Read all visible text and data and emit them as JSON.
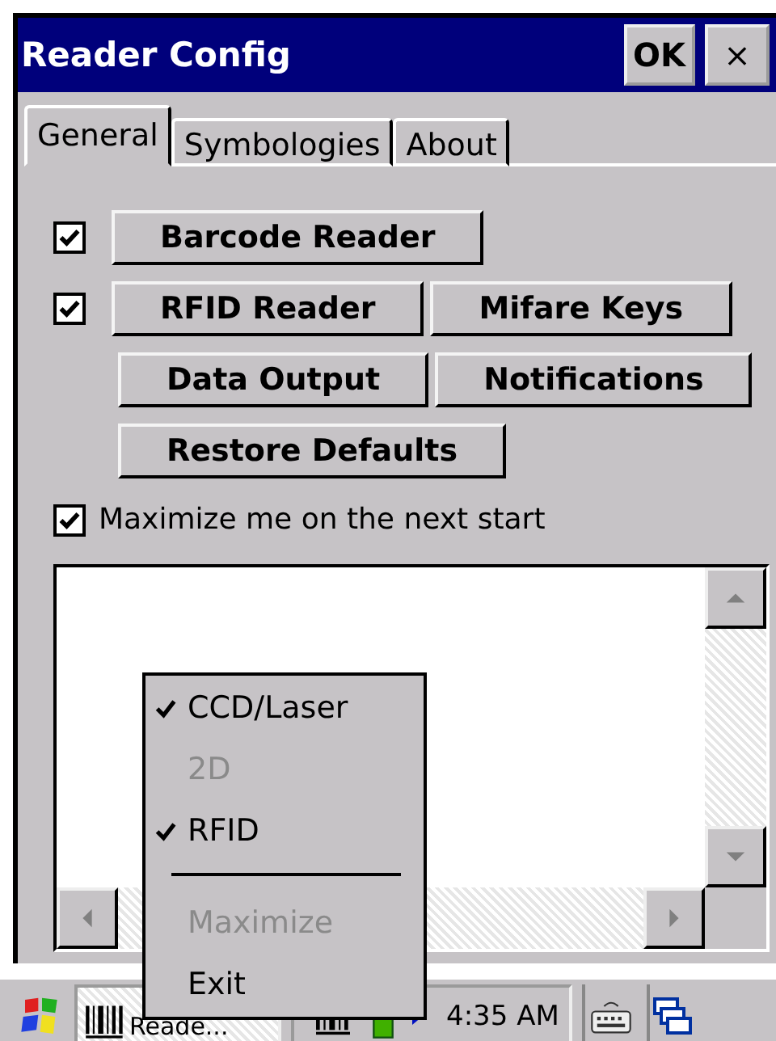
{
  "window": {
    "title": "Reader Config",
    "buttons": [
      {
        "label": "OK",
        "kind": "ok"
      },
      {
        "label": "×",
        "kind": "close"
      }
    ]
  },
  "tabs": [
    {
      "label": "General",
      "selected": true
    },
    {
      "label": "Symbologies",
      "selected": false
    },
    {
      "label": "About",
      "selected": false
    }
  ],
  "options": [
    {
      "kind": "check",
      "checked": true,
      "buttons": [
        "Barcode Reader"
      ]
    },
    {
      "kind": "check",
      "checked": true,
      "buttons": [
        "RFID Reader",
        "Mifare Keys"
      ]
    },
    {
      "kind": "plain",
      "buttons": [
        "Data Output",
        "Notifications"
      ]
    },
    {
      "kind": "plain",
      "buttons": [
        "Restore Defaults"
      ]
    }
  ],
  "maximize": {
    "label": "Maximize me on the next start",
    "checked": true
  },
  "context_menu": {
    "items": [
      {
        "kind": "item",
        "label": "CCD/Laser",
        "checked": true,
        "disabled": false
      },
      {
        "kind": "item",
        "label": "2D",
        "checked": false,
        "disabled": true
      },
      {
        "kind": "item",
        "label": "RFID",
        "checked": true,
        "disabled": false
      },
      {
        "kind": "separator"
      },
      {
        "kind": "item",
        "label": "Maximize",
        "checked": false,
        "disabled": true
      },
      {
        "kind": "item",
        "label": "Exit",
        "checked": false,
        "disabled": false
      }
    ]
  },
  "taskbar": {
    "task": "Reade...",
    "clock": "4:35 AM"
  }
}
